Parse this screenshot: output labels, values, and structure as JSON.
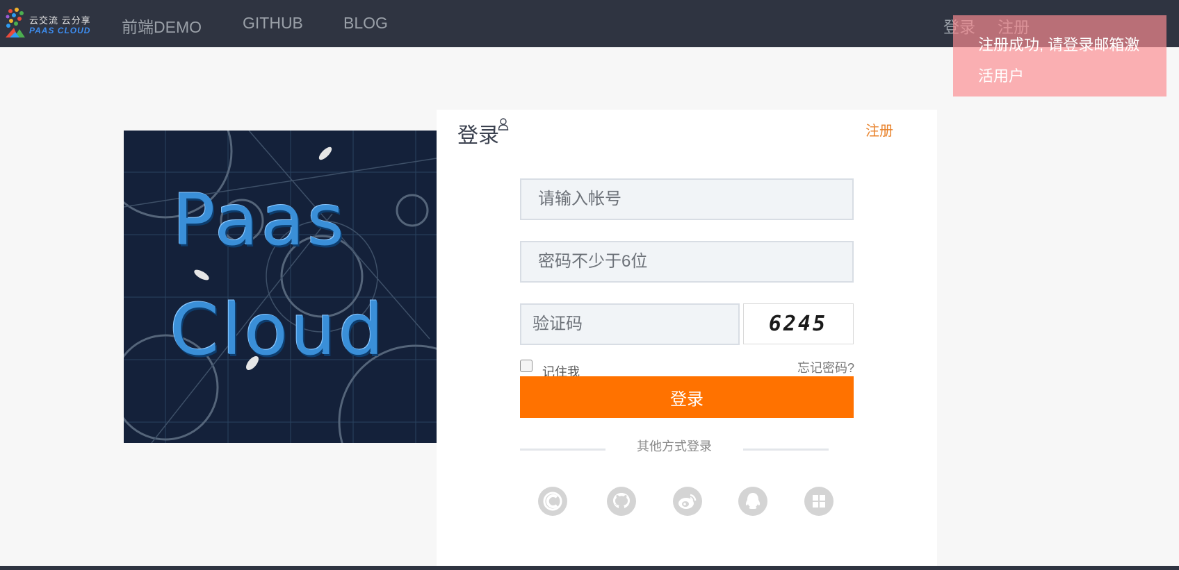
{
  "brand": {
    "logo_line1": "云交流 云分享",
    "logo_line2": "PAAS CLOUD"
  },
  "nav": {
    "links": [
      "前端DEMO",
      "GITHUB",
      "BLOG"
    ],
    "login": "登录",
    "register": "注册"
  },
  "notification": {
    "message": "注册成功, 请登录邮箱激活用户"
  },
  "banner": {
    "line1": "Paas",
    "line2": "Cloud"
  },
  "login_form": {
    "title": "登录",
    "register_link": "注册",
    "account_placeholder": "请输入帐号",
    "password_placeholder": "密码不少于6位",
    "captcha_placeholder": "验证码",
    "captcha_code": "6245",
    "remember_label": "记住我",
    "forgot_label": "忘记密码?",
    "submit_label": "登录",
    "other_methods_label": "其他方式登录"
  },
  "social_icons": [
    "c-logo-icon",
    "github-icon",
    "weibo-icon",
    "qq-icon",
    "windows-icon"
  ],
  "colors": {
    "navbar": "#2f3441",
    "accent": "#ff7200",
    "register_link": "#e8822b",
    "toast": "#fa8c91"
  }
}
